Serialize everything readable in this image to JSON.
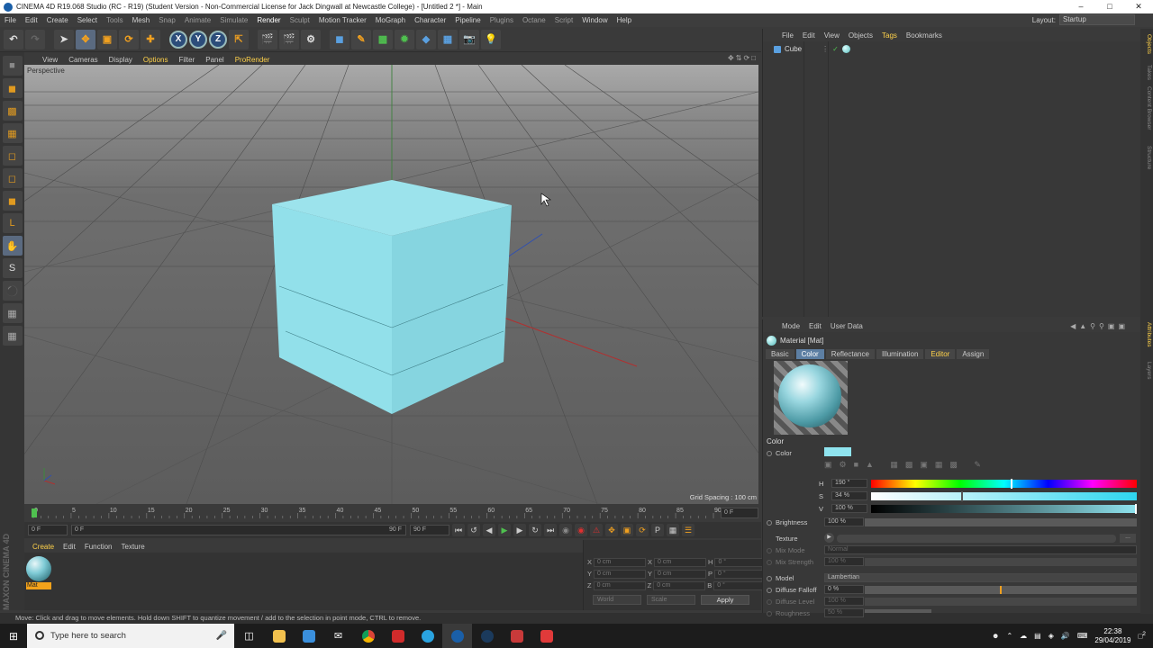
{
  "window": {
    "title": "CINEMA 4D R19.068 Studio (RC - R19) (Student Version - Non-Commercial License for Jack Dingwall at Newcastle College) - [Untitled 2 *] - Main"
  },
  "menubar": {
    "items": [
      "File",
      "Edit",
      "Create",
      "Select",
      "Tools",
      "Mesh",
      "Snap",
      "Animate",
      "Simulate",
      "Render",
      "Sculpt",
      "Motion Tracker",
      "MoGraph",
      "Character",
      "Pipeline",
      "Plugins",
      "Octane",
      "Script",
      "Window",
      "Help"
    ],
    "layout_label": "Layout:",
    "layout_value": "Startup"
  },
  "viewport": {
    "menu": [
      "View",
      "Cameras",
      "Display",
      "Options",
      "Filter",
      "Panel",
      "ProRender"
    ],
    "active_menu": "Options",
    "label": "Perspective",
    "grid_spacing": "Grid Spacing : 100 cm",
    "cube_color": "#95dfe9"
  },
  "timeline": {
    "ticks": [
      "0",
      "5",
      "10",
      "15",
      "20",
      "25",
      "30",
      "35",
      "40",
      "45",
      "50",
      "55",
      "60",
      "65",
      "70",
      "75",
      "80",
      "85",
      "90"
    ],
    "current_frame": "0 F",
    "start_frame": "0 F",
    "range_start": "0 F",
    "range_end": "90 F",
    "end_frame": "90 F"
  },
  "material_manager": {
    "menu": [
      "Create",
      "Edit",
      "Function",
      "Texture"
    ],
    "material_name": "Mat",
    "brand": "MAXON CINEMA 4D"
  },
  "coordinates": {
    "rows": [
      {
        "a_label": "X",
        "a": "0 cm",
        "b_label": "X",
        "b": "0 cm",
        "c_label": "H",
        "c": "0 °"
      },
      {
        "a_label": "Y",
        "a": "0 cm",
        "b_label": "Y",
        "b": "0 cm",
        "c_label": "P",
        "c": "0 °"
      },
      {
        "a_label": "Z",
        "a": "0 cm",
        "b_label": "Z",
        "b": "0 cm",
        "c_label": "B",
        "c": "0 °"
      }
    ],
    "mode": "World",
    "scale": "Scale",
    "apply": "Apply"
  },
  "object_manager": {
    "menu": [
      "File",
      "Edit",
      "View",
      "Objects",
      "Tags",
      "Bookmarks"
    ],
    "object_name": "Cube"
  },
  "attributes": {
    "menu": [
      "Mode",
      "Edit",
      "User Data"
    ],
    "title": "Material [Mat]",
    "tabs": [
      "Basic",
      "Color",
      "Reflectance",
      "Illumination",
      "Editor",
      "Assign"
    ],
    "active_tab": "Color",
    "section": "Color",
    "color_label": "Color",
    "color_swatch": "#8fe4ef",
    "h_label": "H",
    "h_value": "190 °",
    "h_fraction": 0.53,
    "s_label": "S",
    "s_value": "34 %",
    "s_fraction": 0.34,
    "v_label": "V",
    "v_value": "100 %",
    "v_fraction": 1.0,
    "brightness_label": "Brightness",
    "brightness_value": "100 %",
    "texture_label": "Texture",
    "mix_mode_label": "Mix Mode",
    "mix_mode_value": "Normal",
    "mix_strength_label": "Mix Strength",
    "mix_strength_value": "100 %",
    "model_label": "Model",
    "model_value": "Lambertian",
    "diffuse_falloff_label": "Diffuse Falloff",
    "diffuse_falloff_value": "0 %",
    "diffuse_falloff_fraction": 0.5,
    "diffuse_level_label": "Diffuse Level",
    "diffuse_level_value": "100 %",
    "roughness_label": "Roughness",
    "roughness_value": "50 %"
  },
  "right_tabs": [
    "Objects",
    "Takes",
    "Content Browser",
    "Structure",
    "Attributes",
    "Layers"
  ],
  "statusbar": {
    "text": "Move: Click and drag to move elements. Hold down SHIFT to quantize movement / add to the selection in point mode, CTRL to remove."
  },
  "taskbar": {
    "search_placeholder": "Type here to search",
    "time": "22:38",
    "date": "29/04/2019",
    "notification_count": "2"
  }
}
